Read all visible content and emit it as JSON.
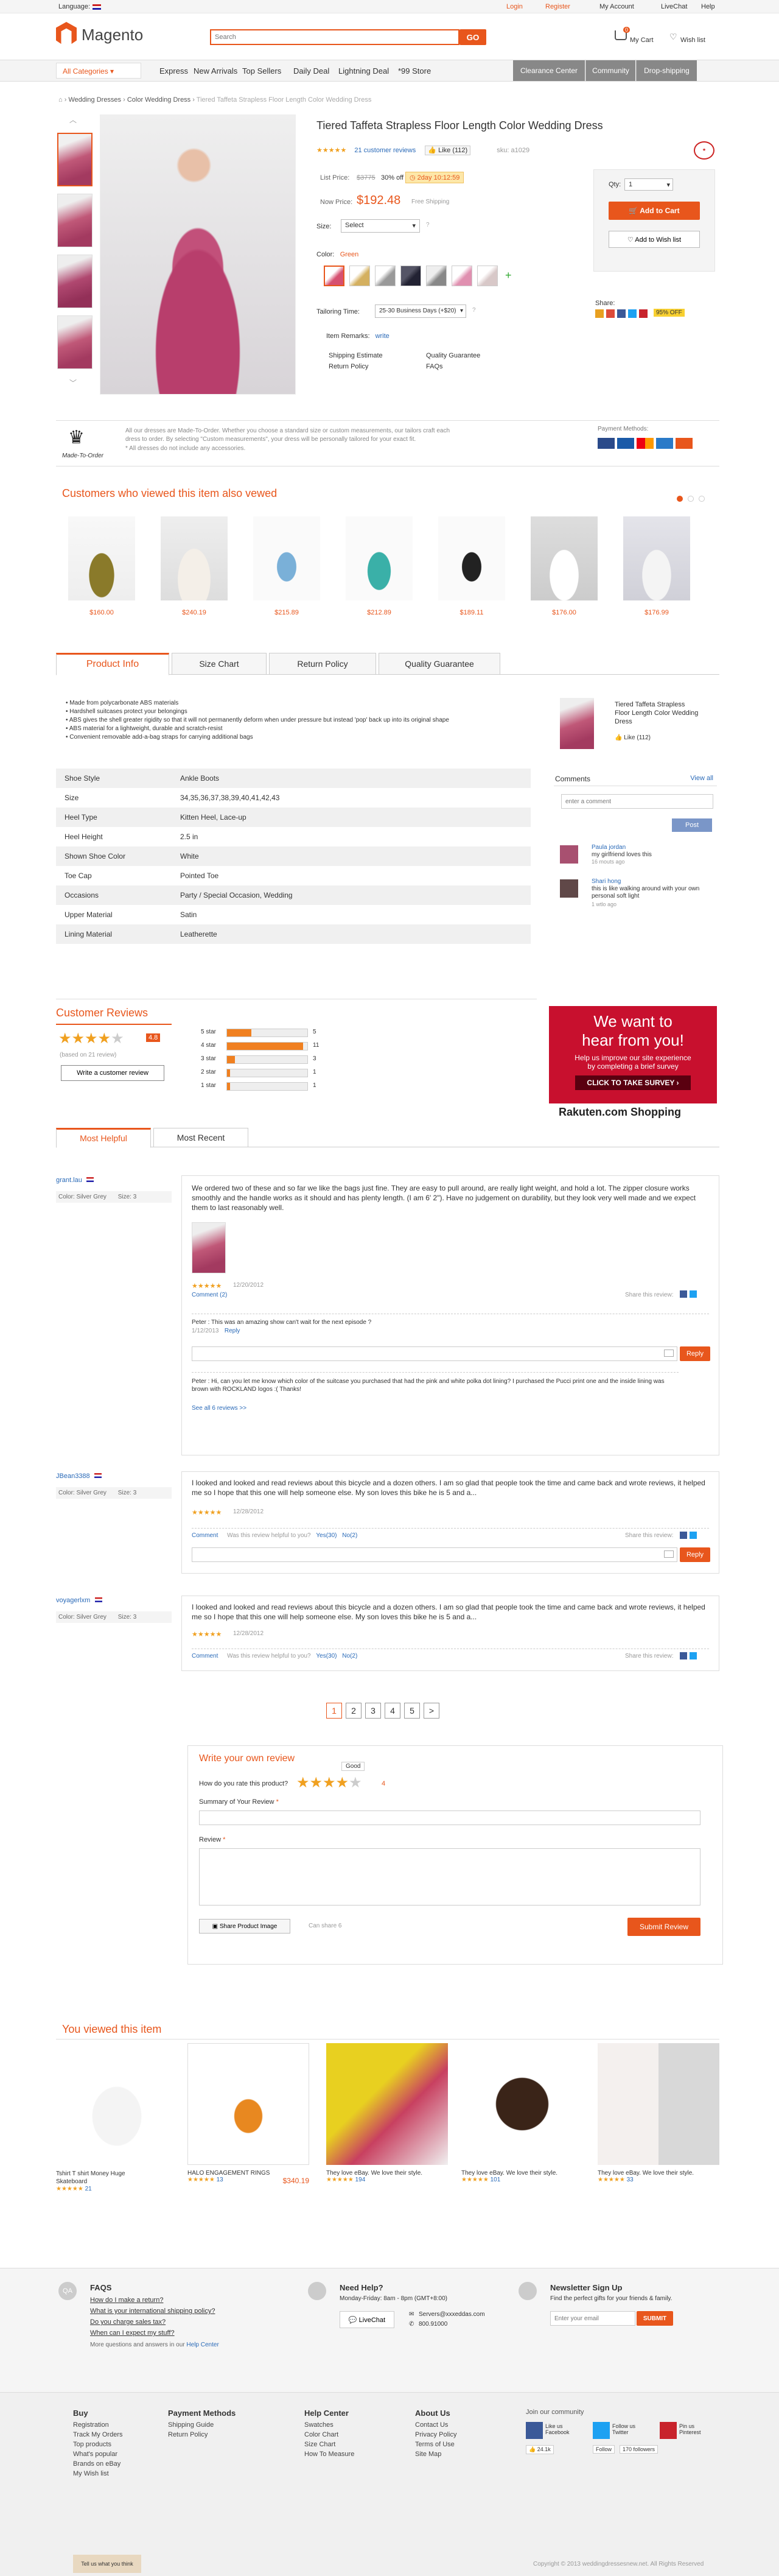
{
  "topbar": {
    "language_label": "Language:",
    "login": "Login",
    "register": "Register",
    "my_account": "My Account",
    "livechat": "LiveChat",
    "help": "Help"
  },
  "header": {
    "logo": "Magento",
    "search_placeholder": "Search",
    "search_btn": "GO",
    "cart": "My Cart",
    "cart_count": "0",
    "wishlist": "Wish list"
  },
  "nav": {
    "all_categories": "All Categories",
    "items": [
      "Express",
      "New Arrivals",
      "Top Sellers",
      "Daily Deal",
      "Lightning Deal",
      "*99 Store"
    ],
    "right": [
      "Clearance Center",
      "Community",
      "Drop-shipping"
    ]
  },
  "breadcrumb": [
    "Wedding Dresses",
    "Color Wedding Dress",
    "Tiered Taffeta Strapless Floor Length Color Wedding Dress"
  ],
  "product": {
    "title": "Tiered Taffeta Strapless Floor Length Color Wedding Dress",
    "reviews_link": "21 customer reviews",
    "like": "Like (112)",
    "sku": "sku: a1029",
    "list_price_label": "List Price:",
    "list_price": "$3775",
    "discount": "30% off",
    "countdown": "2day 10:12:59",
    "now_price_label": "Now Price:",
    "now_price": "$192.48",
    "free_shipping": "Free Shipping",
    "size_label": "Size:",
    "size_value": "Select",
    "color_label": "Color:",
    "color_value": "Green",
    "tailoring_label": "Tailoring Time:",
    "tailoring_value": "25-30 Business Days (+$20)",
    "remarks_label": "Item Remarks:",
    "remarks_link": "write",
    "links": [
      "Shipping Estimate",
      "Quality Guarantee",
      "Return Policy",
      "FAQs"
    ],
    "qty_label": "Qty:",
    "qty_value": "1",
    "add_to_cart": "Add to Cart",
    "add_wishlist": "Add to Wish list",
    "share_label": "Share:",
    "share_badge": "95% OFF"
  },
  "made_to_order": {
    "brand": "Made-To-Order",
    "text1": "All our dresses are Made-To-Order. Whether you choose a standard size or custom measurements, our tailors craft each dress to order. By selecting \"Custom measurements\", your dress will be personally tailored for your exact fit.",
    "text2": "* All dresses do not include any accessories.",
    "payment_label": "Payment Methods:"
  },
  "also_viewed": {
    "title": "Customers who viewed this item also vewed",
    "prices": [
      "$160.00",
      "$240.19",
      "$215.89",
      "$212.89",
      "$189.11",
      "$176.00",
      "$176.99"
    ]
  },
  "tabs": [
    "Product Info",
    "Size Chart",
    "Return Policy",
    "Quality Guarantee"
  ],
  "features": [
    "Made from polycarbonate ABS materials",
    "Hardshell suitcases protect your belongings",
    "ABS gives the shell greater rigidity so that it will not permanently deform when under pressure but instead 'pop' back up into its original shape",
    "ABS material for a lightweight, durable and scratch-resist",
    "Convenient removable add-a-bag straps for carrying additional bags"
  ],
  "specs": [
    [
      "Shoe Style",
      "Ankle Boots"
    ],
    [
      "Size",
      "34,35,36,37,38,39,40,41,42,43"
    ],
    [
      "Heel Type",
      "Kitten Heel, Lace-up"
    ],
    [
      "Heel Height",
      "2.5 in"
    ],
    [
      "Shown Shoe Color",
      "White"
    ],
    [
      "Toe Cap",
      "Pointed Toe"
    ],
    [
      "Occasions",
      "Party / Special Occasion, Wedding"
    ],
    [
      "Upper Material",
      "Satin"
    ],
    [
      "Lining Material",
      "Leatherette"
    ]
  ],
  "side_product": {
    "title": "Tiered Taffeta Strapless Floor Length Color Wedding Dress",
    "like": "Like (112)"
  },
  "comments": {
    "title": "Comments",
    "view_all": "View all",
    "placeholder": "enter a comment",
    "post": "Post",
    "items": [
      {
        "name": "Paula jordan",
        "text": "my girlfriend loves this",
        "time": "16 mouts ago"
      },
      {
        "name": "Shari hong",
        "text": "this is like walking around with your own personal soft light",
        "time": "1 wtlo ago"
      }
    ]
  },
  "reviews": {
    "title": "Customer Reviews",
    "score": "4.8",
    "based": "(based on 21 review)",
    "write": "Write a customer review",
    "bars": [
      {
        "label": "5 star",
        "count": "5",
        "pct": 0.3
      },
      {
        "label": "4 star",
        "count": "11",
        "pct": 0.95
      },
      {
        "label": "3 star",
        "count": "3",
        "pct": 0.1
      },
      {
        "label": "2 star",
        "count": "1",
        "pct": 0.04
      },
      {
        "label": "1 star",
        "count": "1",
        "pct": 0.04
      }
    ],
    "tabs": [
      "Most Helpful",
      "Most Recent"
    ]
  },
  "ad": {
    "line1": "We want to",
    "line2": "hear from you!",
    "sub": "Help us improve our site experience by completing a brief survey",
    "cta": "CLICK TO TAKE SURVEY ›",
    "brand": "Rakuten.com Shopping"
  },
  "review_items": [
    {
      "user": "grant.lau",
      "color_label": "Color:",
      "color": "Silver Grey",
      "size_label": "Size:",
      "size": "3",
      "text": "We ordered two of these and so far we like the bags just fine. They are easy to pull around, are really light weight, and hold a lot. The zipper closure works smoothly and the handle works as it should and has plenty length. (I am 6' 2\"). Have no judgement on durability, but they look very well made and we expect them to last reasonably well.",
      "date": "12/20/2012",
      "comment": "Comment (2)",
      "share": "Share this review:",
      "replies": [
        {
          "text": "Peter : This was an amazing show can't wait for the next episode ?",
          "date": "1/12/2013",
          "reply": "Reply"
        }
      ],
      "reply_btn": "Reply",
      "long_reply": "Peter : Hi, can you let me know which color of the suitcase you purchased that had the pink and white polka dot lining? I purchased the Pucci print one and the inside lining was brown with ROCKLAND logos :( Thanks!",
      "see_all": "See all 6 reviews >>"
    },
    {
      "user": "JBean3388",
      "color_label": "Color:",
      "color": "Silver Grey",
      "size_label": "Size:",
      "size": "3",
      "text": "I looked and looked and read reviews about this bicycle and a dozen others. I am so glad that people took the time and came back and wrote reviews, it helped me so I hope that this one will help someone else. My son loves this bike he is 5 and a...",
      "date": "12/28/2012",
      "comment": "Comment",
      "helpful": "Was this review helpful to you?",
      "yes": "Yes(30)",
      "no": "No(2)",
      "share": "Share this review:",
      "reply_btn": "Reply"
    },
    {
      "user": "voyagerlxm",
      "color_label": "Color:",
      "color": "Silver Grey",
      "size_label": "Size:",
      "size": "3",
      "text": "I looked and looked and read reviews about this bicycle and a dozen others. I am so glad that people took the time and came back and wrote reviews, it helped me so I hope that this one will help someone else. My son loves this bike he is 5 and a...",
      "date": "12/28/2012",
      "comment": "Comment",
      "helpful": "Was this review helpful to you?",
      "yes": "Yes(30)",
      "no": "No(2)",
      "share": "Share this review:"
    }
  ],
  "pagination": [
    "1",
    "2",
    "3",
    "4",
    "5",
    ">"
  ],
  "write_review": {
    "title": "Write your own review",
    "tooltip": "Good",
    "rate_q": "How do you rate this product?",
    "rate_val": "4",
    "summary_label": "Summary of Your Review",
    "review_label": "Review",
    "share_image": "Share Product Image",
    "can_share": "Can share 6",
    "submit": "Submit Review"
  },
  "you_viewed": {
    "title": "You viewed this item",
    "items": [
      {
        "name": "Tshirt T shirt Money Huge Skateboard",
        "count": "21",
        "price": ""
      },
      {
        "name": "HALO ENGAGEMENT RINGS",
        "count": "13",
        "price": "$340.19"
      },
      {
        "name": "They love eBay. We love their style.",
        "count": "194",
        "price": ""
      },
      {
        "name": "They love eBay. We love their style.",
        "count": "101",
        "price": ""
      },
      {
        "name": "They love eBay. We love their style.",
        "count": "33",
        "price": ""
      }
    ]
  },
  "footer_info": {
    "faq_title": "FAQS",
    "faqs": [
      "How do I make a return?",
      "What is your international shipping policy?",
      "Do you charge sales tax?",
      "When can I expect my stuff?"
    ],
    "faq_more": "More questions and answers in our",
    "help_center": "Help Center",
    "help_title": "Need Help?",
    "help_hours": "Monday-Friday: 8am - 8pm (GMT+8:00)",
    "livechat": "LiveChat",
    "email": "Servers@xxxeddas.com",
    "phone": "800.91000",
    "news_title": "Newsletter Sign Up",
    "news_sub": "Find the perfect gifts for your friends & family.",
    "news_placeholder": "Enter your email",
    "news_btn": "SUBMIT"
  },
  "footer_links": [
    {
      "title": "Buy",
      "items": [
        "Registration",
        "Track My Orders",
        "Top products",
        "What's popular",
        "Brands on eBay",
        "My Wish list"
      ]
    },
    {
      "title": "Payment Methods",
      "items": [
        "Shipping Guide",
        "Return Policy"
      ]
    },
    {
      "title": "Help Center",
      "items": [
        "Swatches",
        "Color Chart",
        "Size Chart",
        "How To Measure"
      ]
    },
    {
      "title": "About Us",
      "items": [
        "Contact Us",
        "Privacy Policy",
        "Terms of Use",
        "Site Map"
      ]
    }
  ],
  "community": {
    "title": "Join our community",
    "fb": "Like us Facebook",
    "tw": "Follow us Twitter",
    "pin": "Pin us Pinterest",
    "like_count": "24.1k",
    "followers": "170 followers",
    "follow": "Follow"
  },
  "footer_bottom": {
    "tell": "Tell us what you think",
    "copyright": "Copyright © 2013 weddingdressesnew.net. All Rights Reserved"
  }
}
